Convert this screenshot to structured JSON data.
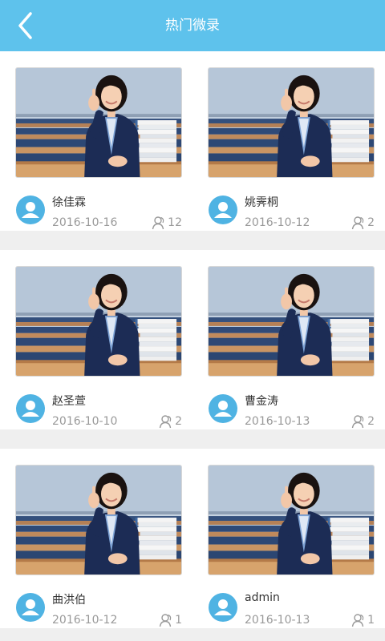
{
  "header": {
    "title": "热门微录"
  },
  "cards": [
    {
      "name": "徐佳霖",
      "date": "2016-10-16",
      "count": "12"
    },
    {
      "name": "姚霁桐",
      "date": "2016-10-12",
      "count": "2"
    },
    {
      "name": "赵圣萱",
      "date": "2016-10-10",
      "count": "2"
    },
    {
      "name": "曹金涛",
      "date": "2016-10-13",
      "count": "2"
    },
    {
      "name": "曲洪伯",
      "date": "2016-10-12",
      "count": "1"
    },
    {
      "name": "admin",
      "date": "2016-10-13",
      "count": "1"
    }
  ],
  "colors": {
    "header": "#5ec2ec",
    "avatar": "#4fb3e3"
  },
  "icons": {
    "back": "chevron-left-icon",
    "avatar": "user-avatar-icon",
    "count": "person-outline-icon"
  }
}
